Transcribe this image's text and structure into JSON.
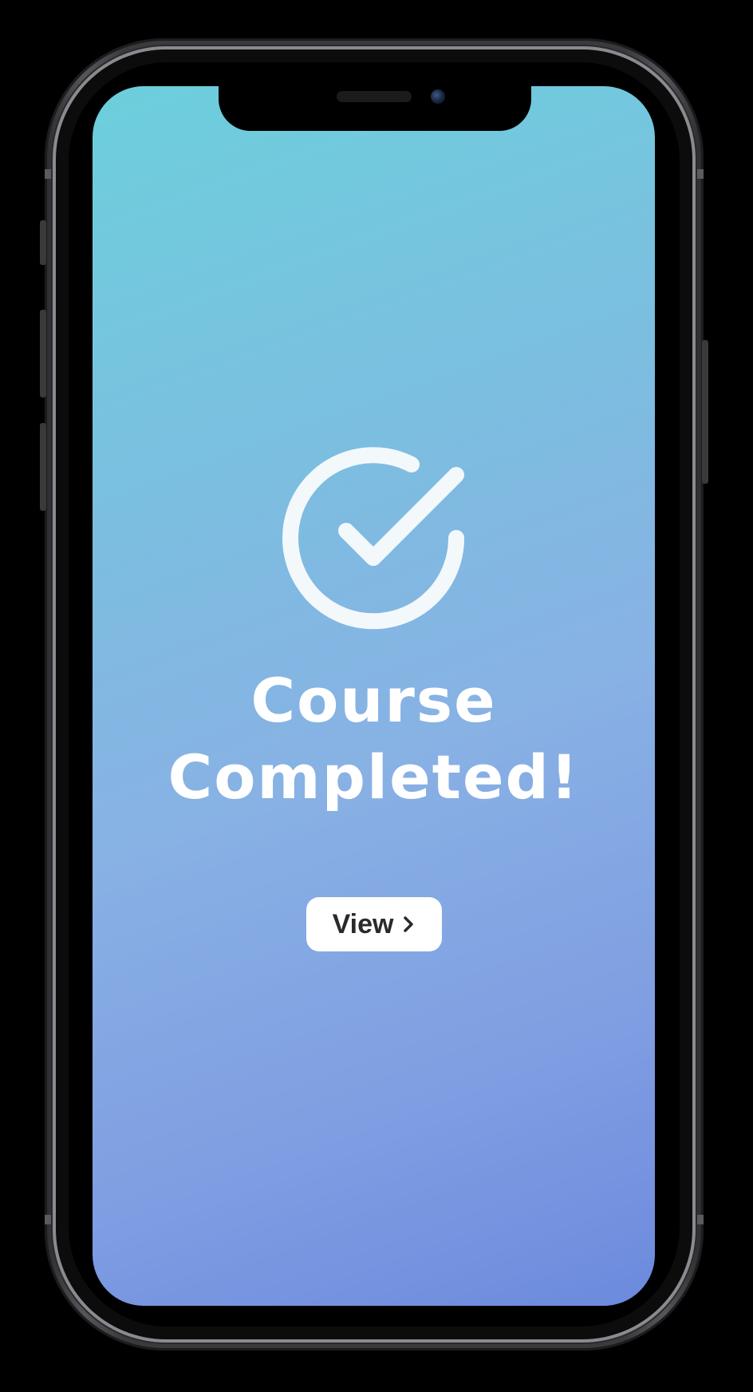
{
  "screen": {
    "title_line1": "Course",
    "title_line2": "Completed!",
    "view_button_label": "View",
    "icons": {
      "status": "check-circle-icon",
      "button": "chevron-right-icon"
    },
    "colors": {
      "gradient_top": "#6ccfdb",
      "gradient_bottom": "#6c8add",
      "text": "#ffffff",
      "button_bg": "#ffffff",
      "button_text": "#2a2a2a"
    }
  }
}
